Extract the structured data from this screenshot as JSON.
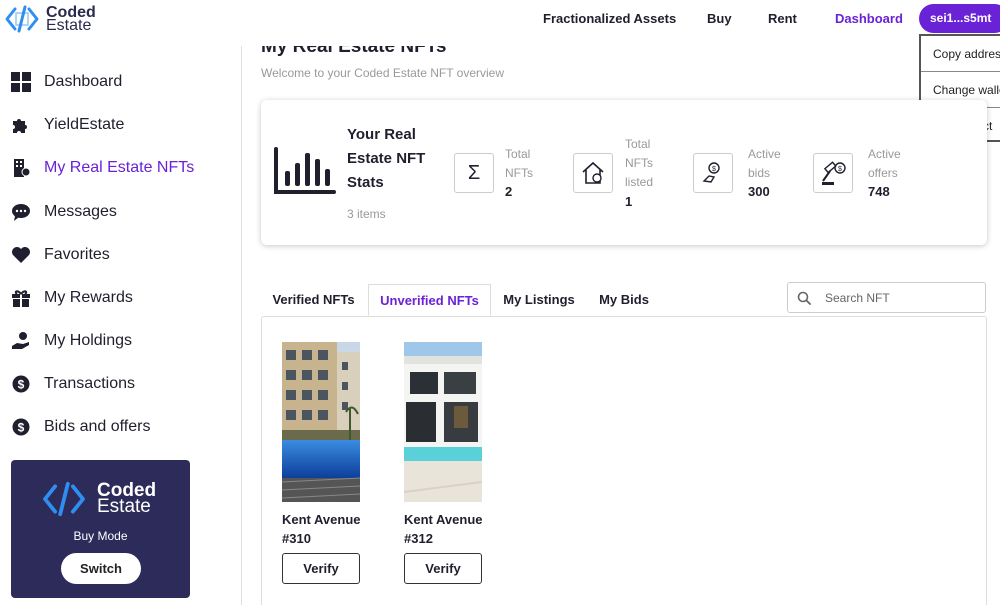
{
  "brand": {
    "line1": "Coded",
    "line2": "Estate"
  },
  "nav": {
    "links": [
      "Fractionalized Assets",
      "Buy",
      "Rent",
      "Dashboard"
    ],
    "active": "Dashboard",
    "wallet_label": "sei1...s5mt"
  },
  "wallet_menu": {
    "items": [
      "Copy address",
      "Change wallet",
      "Disconnect"
    ]
  },
  "sidebar": {
    "items": [
      {
        "label": "Dashboard",
        "icon": "grid-icon"
      },
      {
        "label": "YieldEstate",
        "icon": "puzzle-icon"
      },
      {
        "label": "My Real Estate NFTs",
        "icon": "building-nft-icon",
        "active": true
      },
      {
        "label": "Messages",
        "icon": "chat-icon"
      },
      {
        "label": "Favorites",
        "icon": "heart-icon"
      },
      {
        "label": "My Rewards",
        "icon": "gift-icon"
      },
      {
        "label": "My Holdings",
        "icon": "hand-coin-icon"
      },
      {
        "label": "Transactions",
        "icon": "dollar-circle-icon"
      },
      {
        "label": "Bids and offers",
        "icon": "dollar-circle-icon"
      }
    ]
  },
  "mode_card": {
    "brand_line1": "Coded",
    "brand_line2": "Estate",
    "mode_label": "Buy Mode",
    "switch_label": "Switch"
  },
  "page": {
    "title": "My Real Estate NFTs",
    "subtitle": "Welcome to your Coded Estate NFT overview"
  },
  "stats": {
    "title": "Your Real Estate NFT Stats",
    "items_count": "3 items",
    "cards": [
      {
        "label": "Total NFTs",
        "value": "2",
        "icon": "sigma-icon"
      },
      {
        "label": "Total NFTs listed",
        "value": "1",
        "icon": "house-coin-icon"
      },
      {
        "label": "Active bids",
        "value": "300",
        "icon": "hand-coin-icon"
      },
      {
        "label": "Active offers",
        "value": "748",
        "icon": "auction-hammer-icon"
      }
    ]
  },
  "tabs": {
    "items": [
      "Verified NFTs",
      "Unverified NFTs",
      "My Listings",
      "My Bids"
    ],
    "active": "Unverified NFTs"
  },
  "search": {
    "placeholder": "Search NFT",
    "value": ""
  },
  "nfts": [
    {
      "name_line1": "Kent Avenue",
      "name_line2": "#310",
      "action_label": "Verify"
    },
    {
      "name_line1": "Kent Avenue",
      "name_line2": "#312",
      "action_label": "Verify"
    }
  ],
  "colors": {
    "accent": "#6a22d6",
    "mode_card_bg": "#2d2b5a",
    "logo_blue": "#2f8ff0"
  }
}
